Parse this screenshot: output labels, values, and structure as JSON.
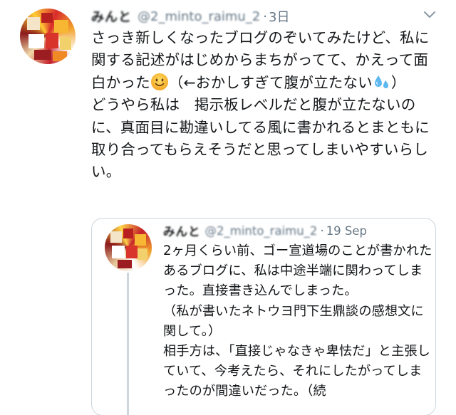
{
  "tweet": {
    "name": "みんと",
    "handle": "@2_minto_raimu_2",
    "separator": "·",
    "date": "3日",
    "body_part1": "さっき新しくなったブログのぞいてみたけど、私に関する記述がはじめからまちがってて、かえって面白かった",
    "emoji1_icon": "smiling-face-emoji",
    "body_part2": "（←おかしすぎて腹が立たない",
    "emoji2_icon": "sweat-droplets-emoji",
    "body_part3": "）\nどうやら私は　掲示板レベルだと腹が立たないのに、真面目に勘違いしてる風に書かれるとまともに取り合ってもらえそうだと思ってしまいやすいらしい。"
  },
  "quoted_tweet": {
    "name": "みんと",
    "handle": "@2_minto_raimu_2",
    "separator": "·",
    "date": "19 Sep",
    "body": "2ヶ月くらい前、ゴー宣道場のことが書かれたあるブログに、私は中途半端に関わってしまった。直接書き込んでしまった。\n（私が書いたネトウヨ門下生鼎談の感想文に関して。）\n相手方は、「直接じゃなきゃ卑怯だ」と主張していて、今考えたら、それにしたがってしまったのが間違いだった。（続"
  },
  "colors": {
    "text": "#14171a",
    "secondary": "#657786",
    "border": "#ccd6dd"
  }
}
